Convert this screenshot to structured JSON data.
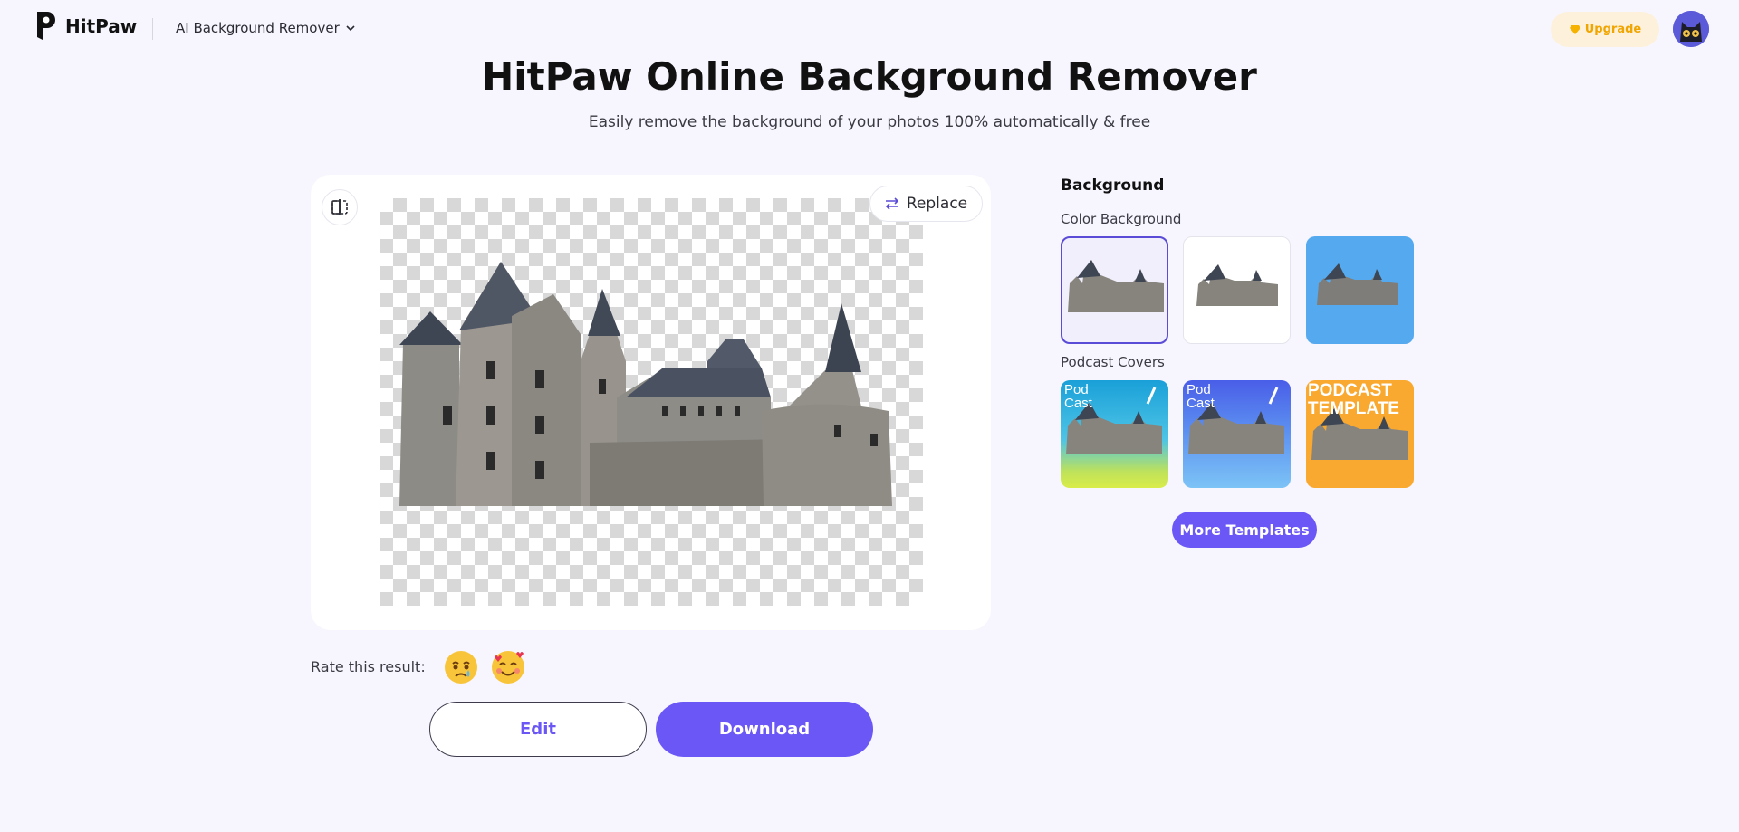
{
  "header": {
    "logo_text": "HitPaw",
    "tool_menu_label": "AI Background Remover",
    "upgrade_label": "Upgrade"
  },
  "hero": {
    "title": "HitPaw Online Background Remover",
    "subtitle": "Easily remove the background of your photos 100% automatically & free"
  },
  "preview": {
    "replace_label": "Replace"
  },
  "panel": {
    "title": "Background",
    "color_section_label": "Color Background",
    "podcast_section_label": "Podcast Covers",
    "color_backgrounds": [
      {
        "name": "transparent",
        "color": "#f1effc",
        "selected": true
      },
      {
        "name": "white",
        "color": "#ffffff",
        "selected": false
      },
      {
        "name": "blue",
        "color": "#55a9ee",
        "selected": false
      }
    ],
    "podcast_covers": [
      {
        "text_line1": "Pod",
        "text_line2": "Cast"
      },
      {
        "text_line1": "Pod",
        "text_line2": "Cast"
      },
      {
        "text_line1": "PODCAST",
        "text_line2": "TEMPLATE"
      }
    ],
    "more_templates_label": "More Templates"
  },
  "rating": {
    "label": "Rate this result:"
  },
  "actions": {
    "edit_label": "Edit",
    "download_label": "Download"
  },
  "colors": {
    "accent": "#6a57f5",
    "upgrade_bg": "#fdf1dc",
    "upgrade_text": "#f0a500",
    "page_bg": "#f7f6fe"
  }
}
